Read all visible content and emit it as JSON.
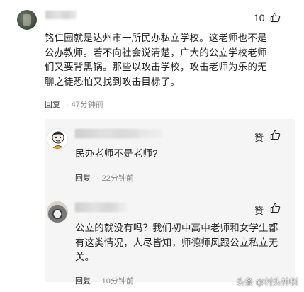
{
  "main_comment": {
    "like_count": "10",
    "lines": [
      "铭仁园就是达州市一所民办私立学校。这老师也不是",
      "公办教师。若不向社会说清楚，广大的公立学校老师",
      "们又要背黑锅。那些以攻击学校，攻击老师为乐的无",
      "聊之徒恐怕又找到攻击目标了。"
    ],
    "reply_label": "回复",
    "time": "47分钟前"
  },
  "replies": [
    {
      "like_label": "赞",
      "lines": [
        "民办老师不是老师?"
      ],
      "reply_label": "回复",
      "time": "22分钟前"
    },
    {
      "like_label": "赞",
      "lines": [
        "公立的就没有吗？我们初中高中老师和女学生都",
        "有这类情况，人尽皆知，师德师风跟公立私立无",
        "关。"
      ],
      "reply_label": "回复",
      "time": "10分钟前"
    }
  ],
  "watermark": "头条 @村头神树",
  "colors": {
    "background": "#ffffff",
    "reply_panel": "#f5f5f5",
    "text": "#222222",
    "muted": "#8a8a8a"
  },
  "icons": {
    "like": "thumbs-up-icon"
  }
}
